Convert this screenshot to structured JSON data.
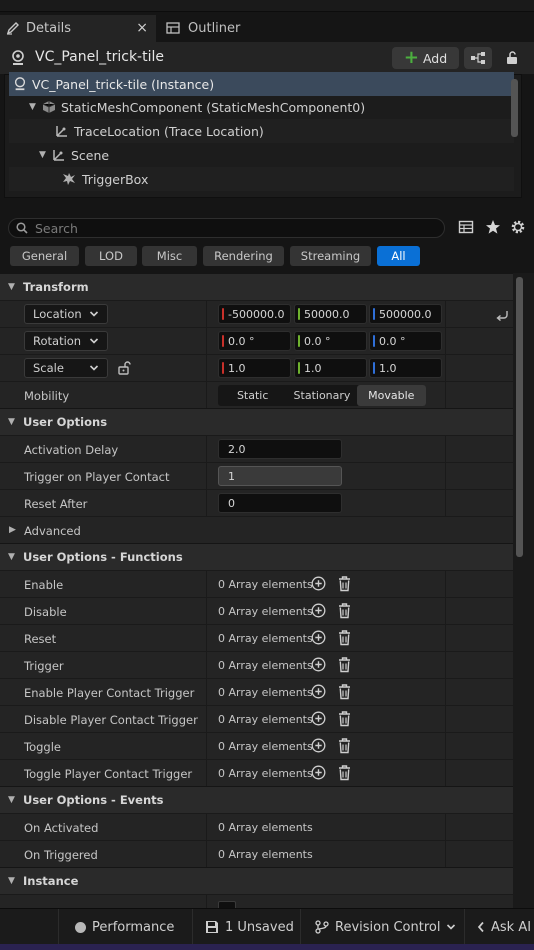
{
  "tabs": [
    {
      "label": "Details",
      "icon": "pencil-icon",
      "active": true
    },
    {
      "label": "Outliner",
      "icon": "outliner-icon",
      "active": false
    }
  ],
  "close_glyph": "×",
  "header": {
    "actor_name": "VC_Panel_trick-tile",
    "add_label": "Add"
  },
  "tree": [
    {
      "label": "VC_Panel_trick-tile (Instance)",
      "selected": true
    },
    {
      "label": "StaticMeshComponent (StaticMeshComponent0)"
    },
    {
      "label": "TraceLocation (Trace Location)"
    },
    {
      "label": "Scene"
    },
    {
      "label": "TriggerBox"
    }
  ],
  "search": {
    "placeholder": "Search"
  },
  "filters": [
    "General",
    "LOD",
    "Misc",
    "Rendering",
    "Streaming",
    "All"
  ],
  "active_filter": "All",
  "transform": {
    "title": "Transform",
    "location": {
      "label": "Location",
      "x": "-500000.0",
      "y": "50000.0",
      "z": "500000.0"
    },
    "rotation": {
      "label": "Rotation",
      "x": "0.0 °",
      "y": "0.0 °",
      "z": "0.0 °"
    },
    "scale": {
      "label": "Scale",
      "x": "1.0",
      "y": "1.0",
      "z": "1.0"
    },
    "mobility": {
      "label": "Mobility",
      "options": [
        "Static",
        "Stationary",
        "Movable"
      ],
      "selected": "Movable"
    }
  },
  "user_options": {
    "title": "User Options",
    "activation_delay": {
      "label": "Activation Delay",
      "value": "2.0"
    },
    "trigger_on_contact": {
      "label": "Trigger on Player Contact",
      "value": "1"
    },
    "reset_after": {
      "label": "Reset After",
      "value": "0"
    }
  },
  "advanced": {
    "title": "Advanced"
  },
  "functions": {
    "title": "User Options - Functions",
    "rows": [
      {
        "label": "Enable",
        "value": "0 Array elements"
      },
      {
        "label": "Disable",
        "value": "0 Array elements"
      },
      {
        "label": "Reset",
        "value": "0 Array elements"
      },
      {
        "label": "Trigger",
        "value": "0 Array elements"
      },
      {
        "label": "Enable Player Contact Trigger",
        "value": "0 Array elements"
      },
      {
        "label": "Disable Player Contact Trigger",
        "value": "0 Array elements"
      },
      {
        "label": "Toggle",
        "value": "0 Array elements"
      },
      {
        "label": "Toggle Player Contact Trigger",
        "value": "0 Array elements"
      }
    ]
  },
  "events": {
    "title": "User Options - Events",
    "rows": [
      {
        "label": "On Activated",
        "value": "0 Array elements"
      },
      {
        "label": "On Triggered",
        "value": "0 Array elements"
      }
    ]
  },
  "instance": {
    "title": "Instance"
  },
  "statusbar": {
    "performance": "Performance",
    "unsaved": "1 Unsaved",
    "revision": "Revision Control",
    "ask_ai": "Ask AI"
  },
  "colors": {
    "accent": "#0a70d6",
    "axis_x": "#c8302a",
    "axis_y": "#6fb22e",
    "axis_z": "#2f6fd8",
    "add_green": "#4caf3f"
  }
}
